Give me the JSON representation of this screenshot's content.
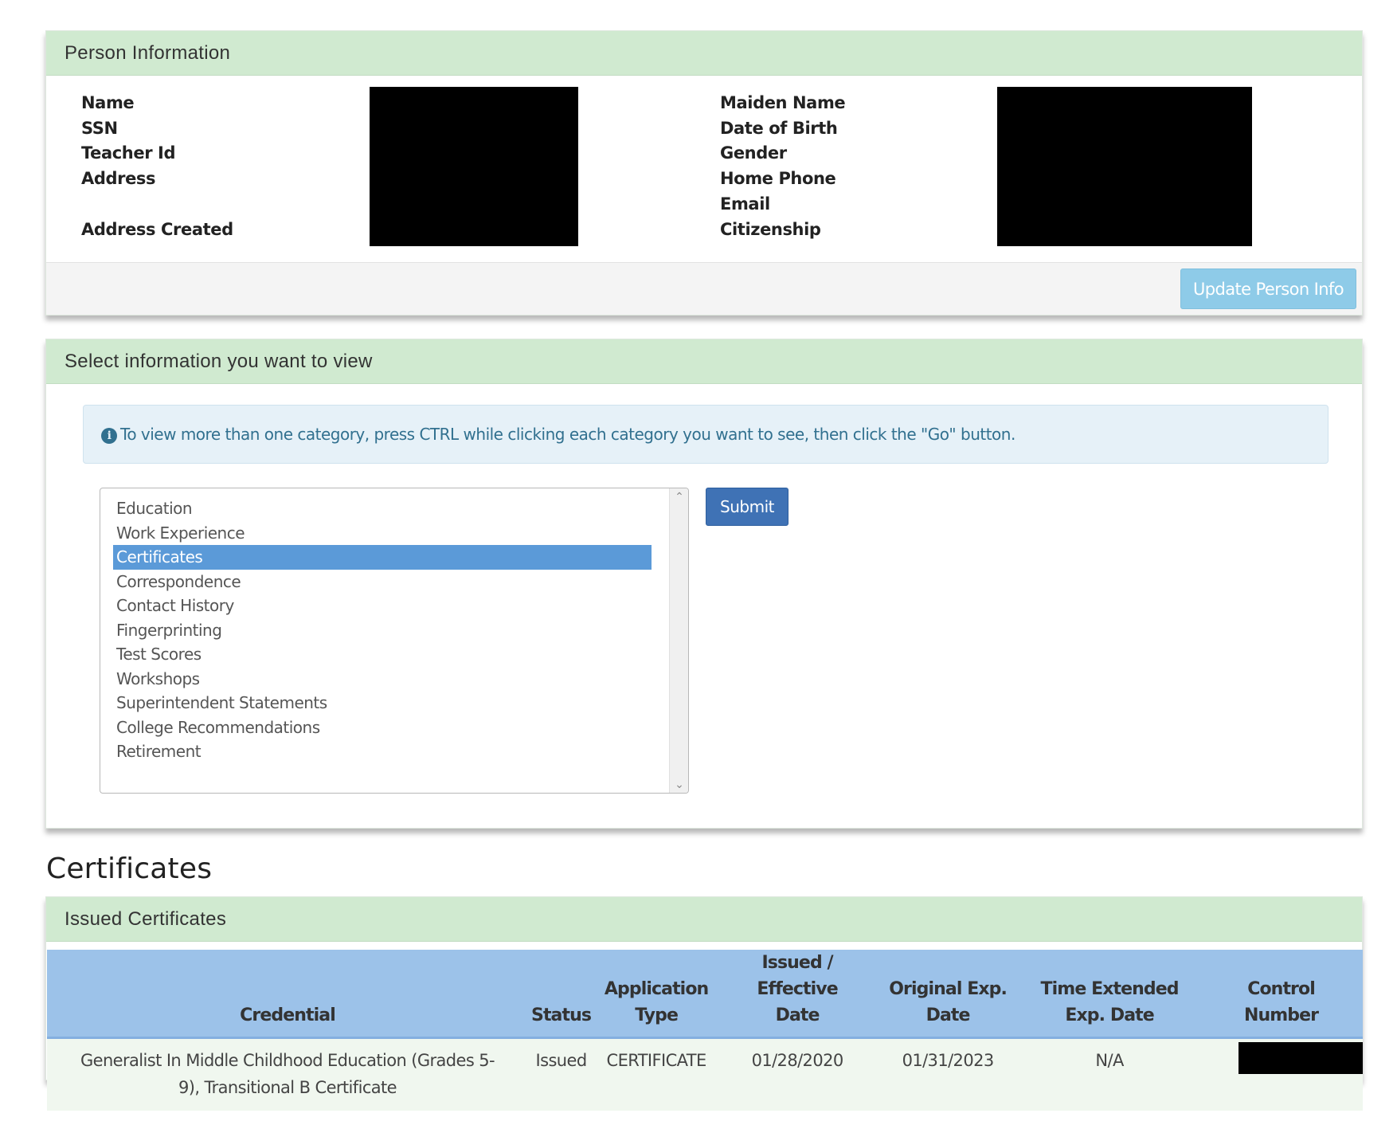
{
  "person_panel": {
    "title": "Person Information",
    "labels_left": [
      "Name",
      "SSN",
      "Teacher Id",
      "Address",
      "Address Created"
    ],
    "labels_right": [
      "Maiden Name",
      "Date of Birth",
      "Gender",
      "Home Phone",
      "Email",
      "Citizenship"
    ],
    "update_button": "Update Person Info"
  },
  "select_panel": {
    "title": "Select information you want to view",
    "info_text": "To view more than one category, press CTRL while clicking each category you want to see, then click the \"Go\" button.",
    "options": [
      "Education",
      "Work Experience",
      "Certificates",
      "Correspondence",
      "Contact History",
      "Fingerprinting",
      "Test Scores",
      "Workshops",
      "Superintendent Statements",
      "College Recommendations",
      "Retirement"
    ],
    "selected_option": "Certificates",
    "submit_button": "Submit"
  },
  "certificates": {
    "section_title": "Certificates",
    "panel_title": "Issued Certificates",
    "columns": [
      [
        "Credential"
      ],
      [
        "Status"
      ],
      [
        "Application",
        "Type"
      ],
      [
        "Issued / Effective",
        "Date"
      ],
      [
        "Original Exp.",
        "Date"
      ],
      [
        "Time Extended",
        "Exp. Date"
      ],
      [
        "Control",
        "Number"
      ]
    ],
    "rows": [
      {
        "credential": [
          "Generalist In Middle Childhood Education (Grades 5-",
          "9), Transitional B Certificate"
        ],
        "status": "Issued",
        "application_type": "CERTIFICATE",
        "issued_date": "01/28/2020",
        "original_exp_date": "01/31/2023",
        "time_extended_exp_date": "N/A"
      }
    ]
  },
  "colors": {
    "panel_heading_bg": "#d0ead0",
    "update_button_bg": "#8ecbe8",
    "submit_button_bg": "#3f72b5",
    "selected_option_bg": "#5b9ad8",
    "table_header_bg": "#9cc2e9",
    "info_alert_bg": "#e6f1f8"
  }
}
